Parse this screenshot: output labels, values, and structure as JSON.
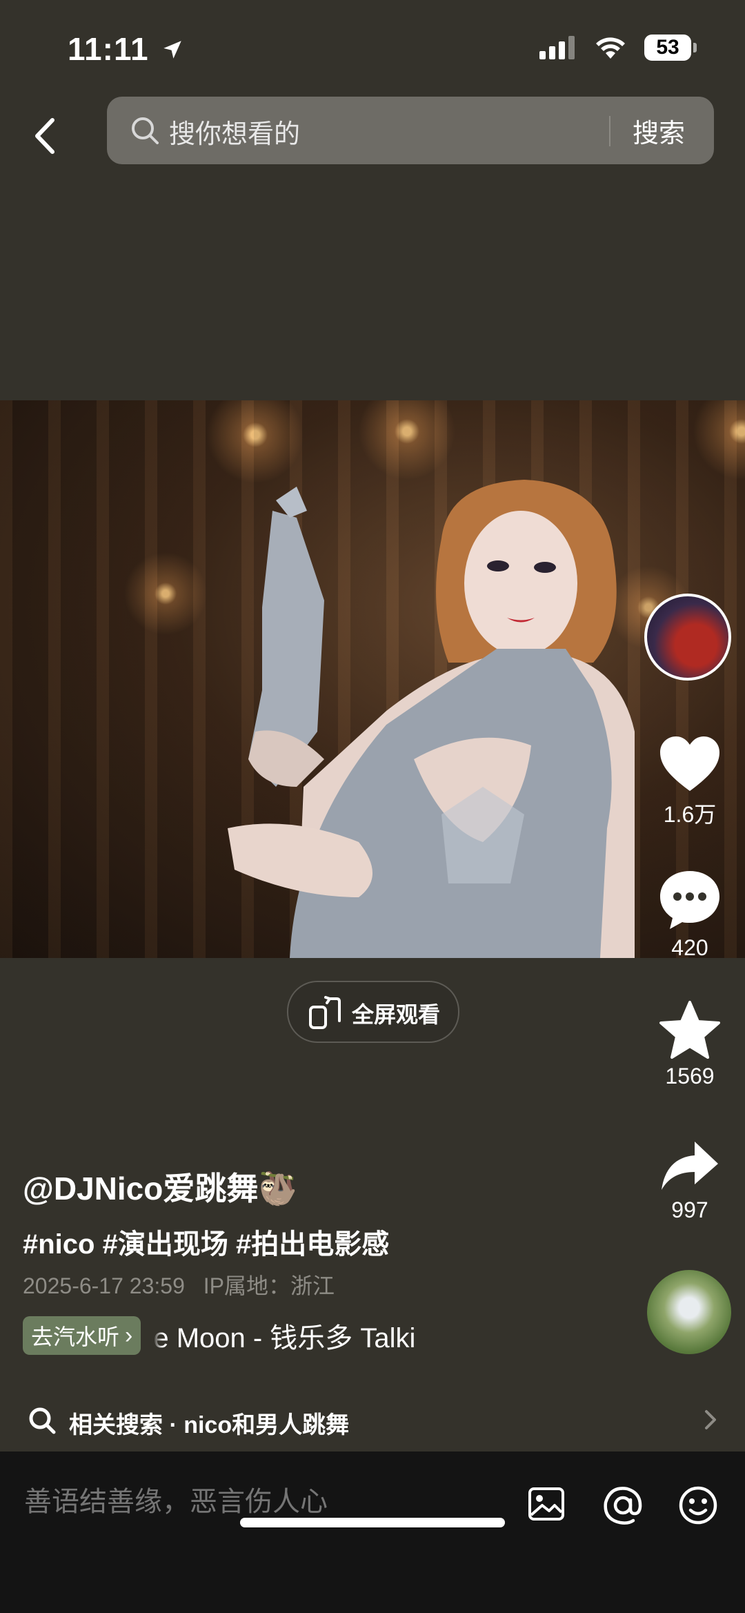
{
  "status_bar": {
    "time": "11:11",
    "battery": "53"
  },
  "search": {
    "placeholder": "搜你想看的",
    "submit_label": "搜索"
  },
  "fullscreen": {
    "label": "全屏观看"
  },
  "actions": {
    "likes": "1.6万",
    "comments": "420",
    "favorites": "1569",
    "shares": "997"
  },
  "post": {
    "author": "@DJNico爱跳舞🦥",
    "tags": "#nico #演出现场 #拍出电影感",
    "date": "2025-6-17 23:59",
    "ip_location": "IP属地：浙江"
  },
  "music": {
    "badge_label": "去汽水听",
    "title": "e Moon - 钱乐多    Talki"
  },
  "related_search": {
    "label": "相关搜索 · nico和男人跳舞"
  },
  "comment_bar": {
    "placeholder": "善语结善缘，恶言伤人心"
  }
}
